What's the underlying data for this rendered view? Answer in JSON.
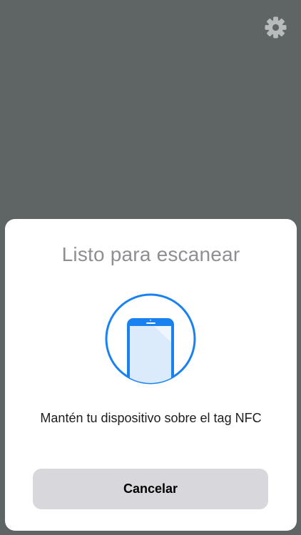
{
  "background_color": "#5f6565",
  "settings": {
    "icon": "gear-icon",
    "color": "#b8bbbb"
  },
  "scan_sheet": {
    "title": "Listo para escanear",
    "illustration": "phone-nfc-icon",
    "accent_color": "#1a82f0",
    "message": "Mantén tu dispositivo sobre el tag NFC",
    "cancel_label": "Cancelar"
  }
}
